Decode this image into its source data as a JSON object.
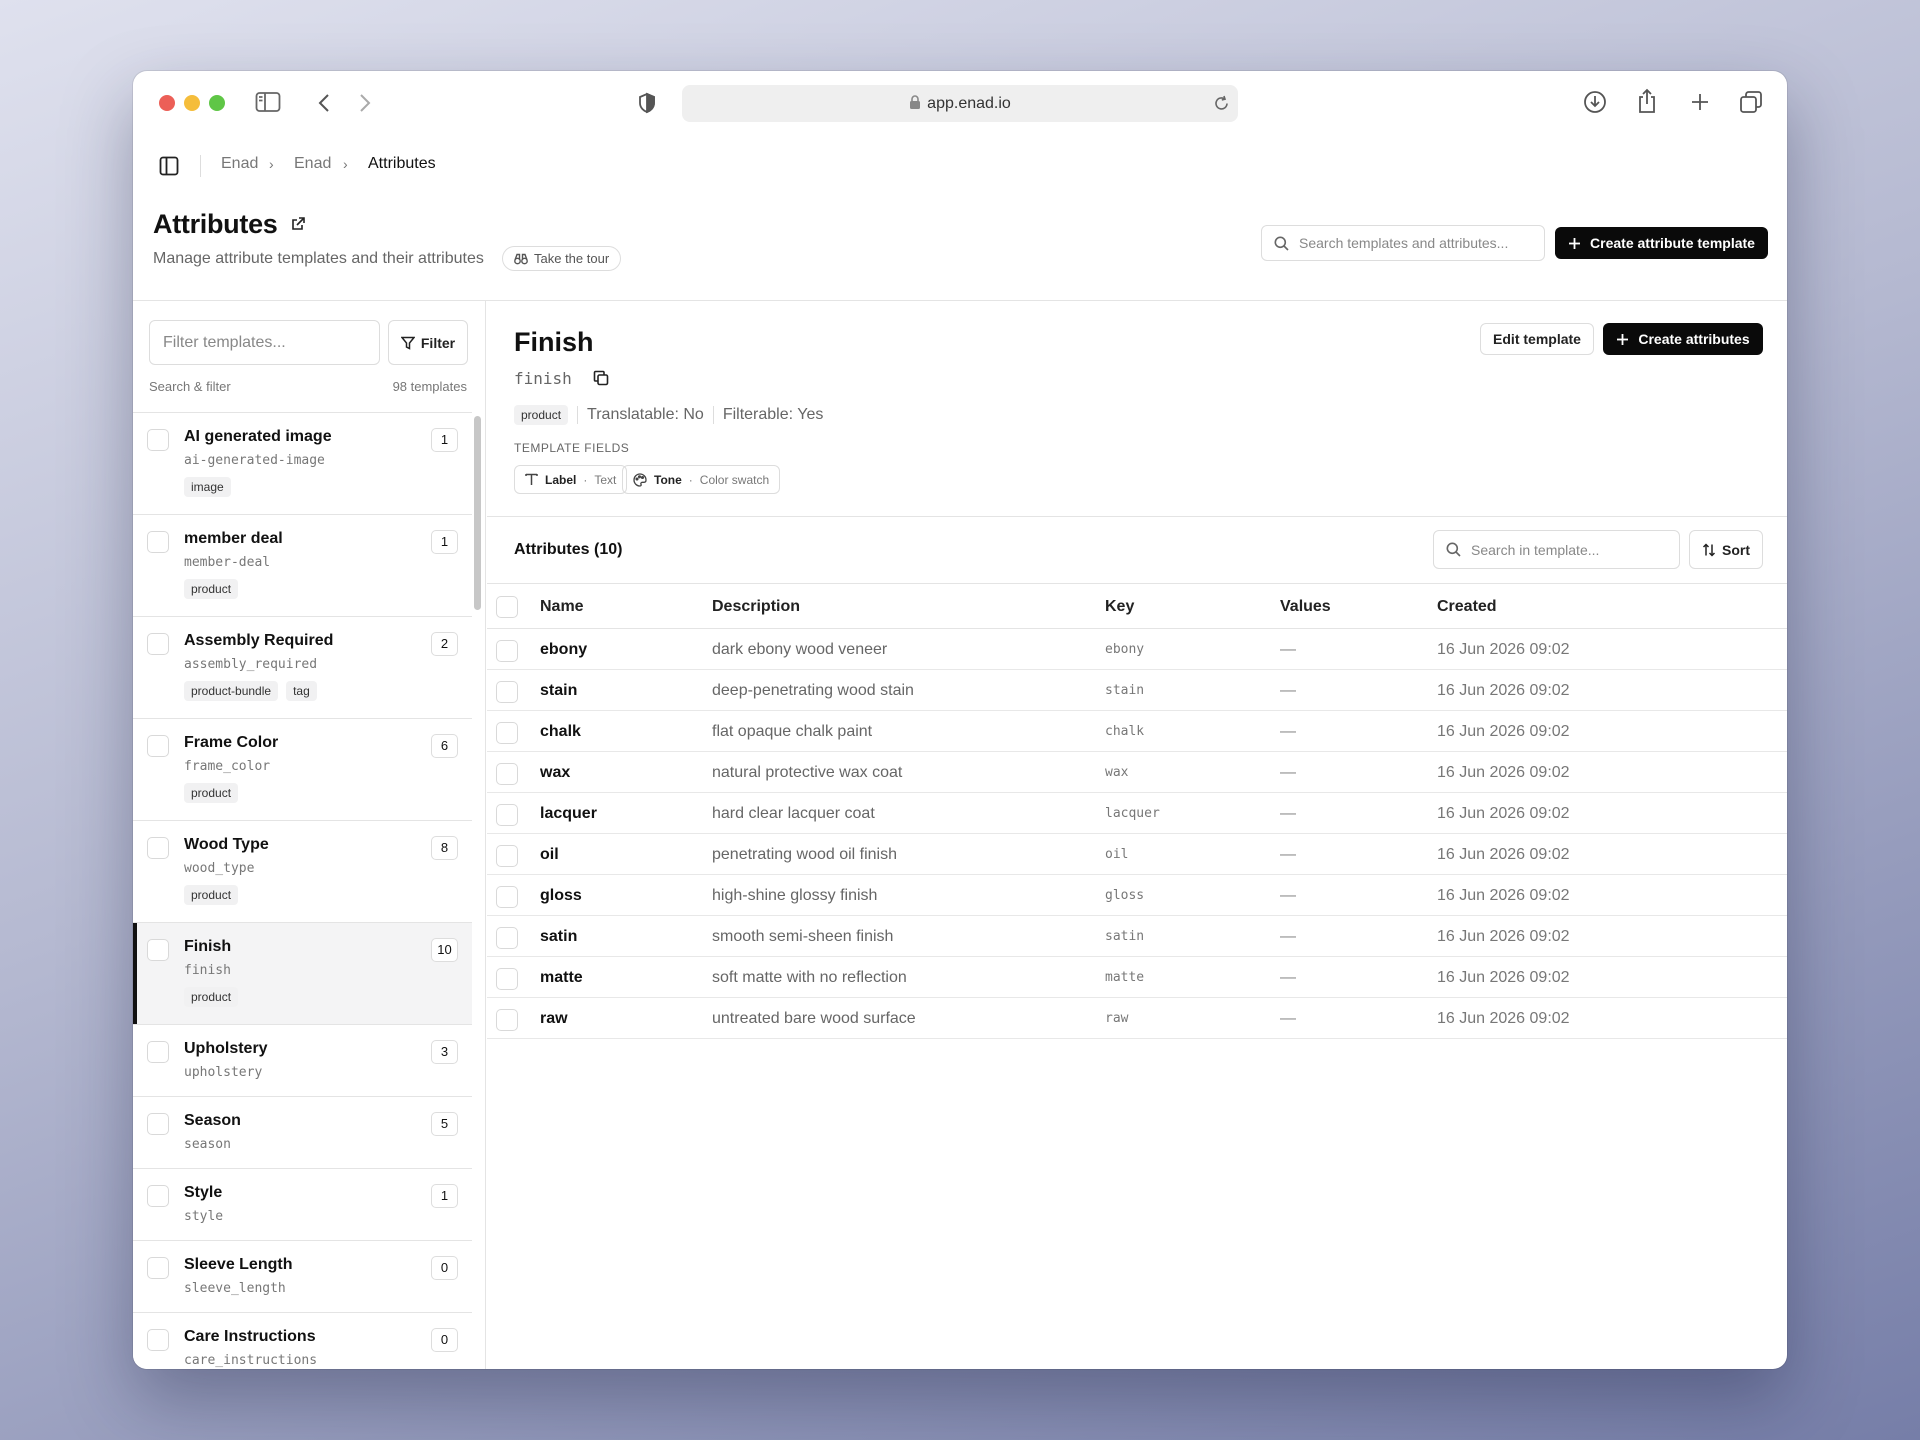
{
  "browser": {
    "url": "app.enad.io"
  },
  "breadcrumb": [
    "Enad",
    "Enad",
    "Attributes"
  ],
  "header": {
    "title": "Attributes",
    "subtitle": "Manage attribute templates and their attributes",
    "tour_label": "Take the tour",
    "search_placeholder": "Search templates and attributes...",
    "create_template_label": "Create attribute template"
  },
  "sidebar": {
    "filter_placeholder": "Filter templates...",
    "filter_button": "Filter",
    "search_filter_label": "Search & filter",
    "count_label": "98 templates",
    "templates": [
      {
        "name": "AI generated image",
        "key": "ai-generated-image",
        "tags": [
          "image"
        ],
        "count": "1",
        "selected": false
      },
      {
        "name": "member deal",
        "key": "member-deal",
        "tags": [
          "product"
        ],
        "count": "1",
        "selected": false
      },
      {
        "name": "Assembly Required",
        "key": "assembly_required",
        "tags": [
          "product-bundle",
          "tag"
        ],
        "count": "2",
        "selected": false
      },
      {
        "name": "Frame Color",
        "key": "frame_color",
        "tags": [
          "product"
        ],
        "count": "6",
        "selected": false
      },
      {
        "name": "Wood Type",
        "key": "wood_type",
        "tags": [
          "product"
        ],
        "count": "8",
        "selected": false
      },
      {
        "name": "Finish",
        "key": "finish",
        "tags": [
          "product"
        ],
        "count": "10",
        "selected": true
      },
      {
        "name": "Upholstery",
        "key": "upholstery",
        "tags": [],
        "count": "3",
        "selected": false
      },
      {
        "name": "Season",
        "key": "season",
        "tags": [],
        "count": "5",
        "selected": false
      },
      {
        "name": "Style",
        "key": "style",
        "tags": [],
        "count": "1",
        "selected": false
      },
      {
        "name": "Sleeve Length",
        "key": "sleeve_length",
        "tags": [],
        "count": "0",
        "selected": false
      },
      {
        "name": "Care Instructions",
        "key": "care_instructions",
        "tags": [],
        "count": "0",
        "selected": false
      }
    ]
  },
  "detail": {
    "title": "Finish",
    "key": "finish",
    "tag": "product",
    "translatable": "Translatable: No",
    "filterable": "Filterable: Yes",
    "template_fields_label": "TEMPLATE FIELDS",
    "fields": [
      {
        "name": "Label",
        "type": "Text",
        "icon": "text-icon"
      },
      {
        "name": "Tone",
        "type": "Color swatch",
        "icon": "palette-icon"
      }
    ],
    "edit_label": "Edit template",
    "create_attributes_label": "Create attributes",
    "attributes_title": "Attributes (10)",
    "search_placeholder": "Search in template...",
    "sort_label": "Sort",
    "columns": [
      "Name",
      "Description",
      "Key",
      "Values",
      "Created"
    ],
    "rows": [
      {
        "name": "ebony",
        "description": "dark ebony wood veneer",
        "key": "ebony",
        "values": "—",
        "created": "16 Jun 2026 09:02"
      },
      {
        "name": "stain",
        "description": "deep-penetrating wood stain",
        "key": "stain",
        "values": "—",
        "created": "16 Jun 2026 09:02"
      },
      {
        "name": "chalk",
        "description": "flat opaque chalk paint",
        "key": "chalk",
        "values": "—",
        "created": "16 Jun 2026 09:02"
      },
      {
        "name": "wax",
        "description": "natural protective wax coat",
        "key": "wax",
        "values": "—",
        "created": "16 Jun 2026 09:02"
      },
      {
        "name": "lacquer",
        "description": "hard clear lacquer coat",
        "key": "lacquer",
        "values": "—",
        "created": "16 Jun 2026 09:02"
      },
      {
        "name": "oil",
        "description": "penetrating wood oil finish",
        "key": "oil",
        "values": "—",
        "created": "16 Jun 2026 09:02"
      },
      {
        "name": "gloss",
        "description": "high-shine glossy finish",
        "key": "gloss",
        "values": "—",
        "created": "16 Jun 2026 09:02"
      },
      {
        "name": "satin",
        "description": "smooth semi-sheen finish",
        "key": "satin",
        "values": "—",
        "created": "16 Jun 2026 09:02"
      },
      {
        "name": "matte",
        "description": "soft matte with no reflection",
        "key": "matte",
        "values": "—",
        "created": "16 Jun 2026 09:02"
      },
      {
        "name": "raw",
        "description": "untreated bare wood surface",
        "key": "raw",
        "values": "—",
        "created": "16 Jun 2026 09:02"
      }
    ]
  },
  "colors": {
    "close": "#ec5f57",
    "minimize": "#f5bd3b",
    "zoom": "#5fc646",
    "primary": "#0a0a0a",
    "selected_bg": "#f4f4f5"
  }
}
